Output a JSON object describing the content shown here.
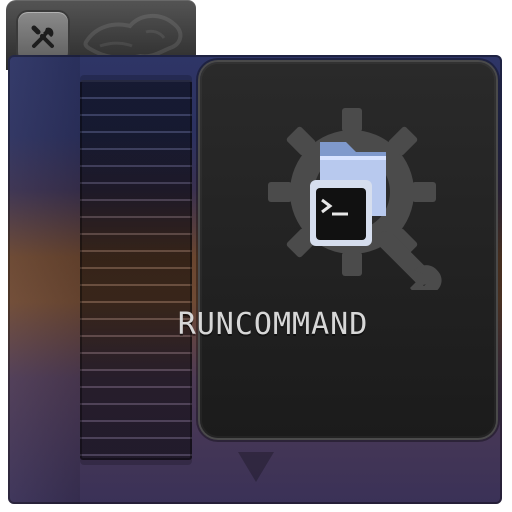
{
  "title": "RUNCOMMAND",
  "icons": {
    "tool": "tools-icon",
    "logo": "lion-logo-icon",
    "gear": "gear-icon",
    "folder": "folder-icon",
    "terminal": "terminal-icon",
    "down_arrow": "down-arrow-icon"
  },
  "colors": {
    "cartridge_top": "#2e3566",
    "cartridge_mid": "#6a4630",
    "cartridge_bottom": "#3a3157",
    "label_bg": "#1f1f1f",
    "title_text": "#d7d7d7",
    "gear": "#4b4b4b"
  }
}
